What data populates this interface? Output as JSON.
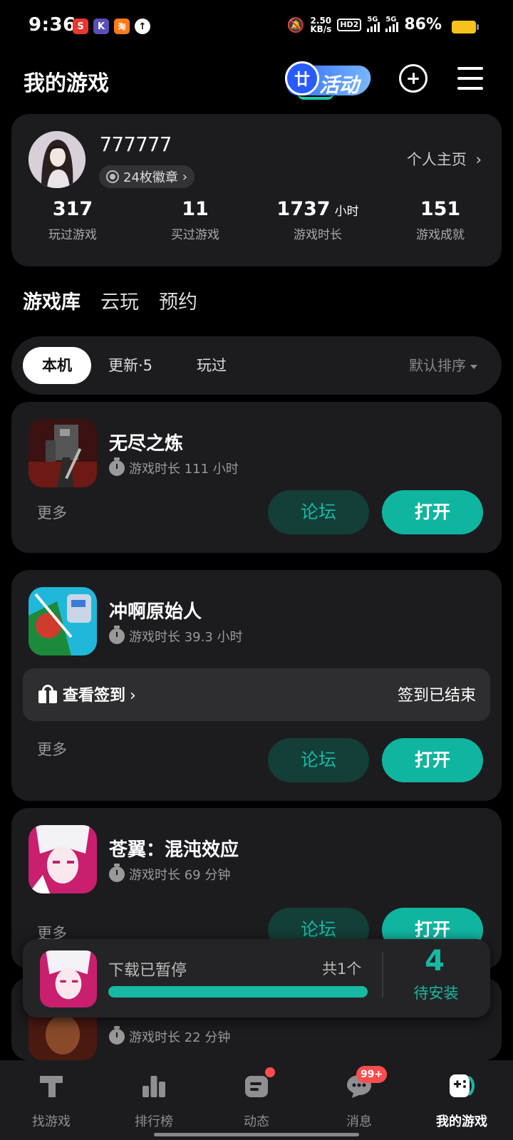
{
  "status_bar": {
    "time": "9:36",
    "net_speed_value": "2.50",
    "net_speed_unit": "KB/s",
    "hd": "HD2",
    "net1": "5G",
    "net2": "5G",
    "battery": "86%",
    "app_badges": [
      {
        "glyph": "S",
        "color": "#e8372d",
        "icon": "app-s-icon"
      },
      {
        "glyph": "K",
        "color": "#5a4fb8",
        "icon": "app-k-icon"
      },
      {
        "glyph": "淘",
        "color": "#ff7a1a",
        "icon": "app-taobao-icon"
      },
      {
        "glyph": "↑",
        "color": "#ffffff",
        "icon": "upload-icon"
      }
    ],
    "battery_color": "#f8c21c"
  },
  "header": {
    "title": "我的游戏",
    "event_label": "活动",
    "event_ticket": "廿"
  },
  "profile": {
    "username": "777777",
    "badges": "24枚徽章",
    "homepage_link": "个人主页",
    "stats": [
      {
        "value": "317",
        "unit": "",
        "label": "玩过游戏"
      },
      {
        "value": "11",
        "unit": "",
        "label": "买过游戏"
      },
      {
        "value": "1737",
        "unit": "小时",
        "label": "游戏时长"
      },
      {
        "value": "151",
        "unit": "",
        "label": "游戏成就"
      }
    ]
  },
  "tabs": [
    "游戏库",
    "云玩",
    "预约"
  ],
  "filters": {
    "local": "本机",
    "updates": "更新·5",
    "played": "玩过",
    "sort": "默认排序"
  },
  "cards": [
    {
      "name": "无尽之炼",
      "playtime": "游戏时长 111 小时",
      "more": "更多",
      "forum": "论坛",
      "open": "打开"
    },
    {
      "name": "冲啊原始人",
      "playtime": "游戏时长 39.3 小时",
      "more": "更多",
      "forum": "论坛",
      "open": "打开",
      "signin_label": "查看签到",
      "signin_status": "签到已结束"
    },
    {
      "name": "苍翼：混沌效应",
      "playtime": "游戏时长 69 分钟",
      "more": "更多",
      "forum": "论坛",
      "open": "打开"
    },
    {
      "playtime": "游戏时长 22 分钟"
    }
  ],
  "download_panel": {
    "state": "下载已暂停",
    "count": "共1个",
    "pending_count": "4",
    "pending_label": "待安装"
  },
  "bottom_nav": [
    {
      "label": "找游戏",
      "icon": "find-game-icon"
    },
    {
      "label": "排行榜",
      "icon": "ranking-icon"
    },
    {
      "label": "动态",
      "icon": "feed-icon"
    },
    {
      "label": "消息",
      "icon": "message-icon"
    },
    {
      "label": "我的游戏",
      "icon": "my-games-icon"
    }
  ],
  "message_badge": "99+",
  "colors": {
    "accent": "#17b9a5",
    "card_bg": "#1c1c1e",
    "badge_red": "#ff4d4f"
  }
}
